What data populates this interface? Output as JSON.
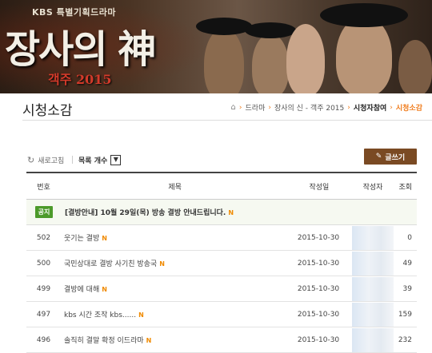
{
  "banner": {
    "network": "KBS 특별기획드라마",
    "title": "장사의 神",
    "subtitle": "객주 2015"
  },
  "page": {
    "title": "시청소감"
  },
  "breadcrumb": {
    "items": [
      "드라마",
      "장사의 신 - 객주 2015",
      "시청자참여",
      "시청소감"
    ]
  },
  "toolbar": {
    "refresh_label": "새로고침",
    "list_count_label": "목록 개수",
    "select_arrow": "▼",
    "write_label": "글쓰기"
  },
  "table": {
    "headers": [
      "번호",
      "제목",
      "작성일",
      "작성자",
      "조회"
    ],
    "notice": {
      "badge": "공지",
      "title": "[결방안내] 10월 29일(목) 방송 결방 안내드립니다.",
      "new_marker": "N"
    },
    "rows": [
      {
        "num": "502",
        "title": "웃기는 결방",
        "new": "N",
        "date": "2015-10-30",
        "views": "0"
      },
      {
        "num": "500",
        "title": "국민상대로 결방 사기친 방송국",
        "new": "N",
        "date": "2015-10-30",
        "views": "49"
      },
      {
        "num": "499",
        "title": "결방에 대해",
        "new": "N",
        "date": "2015-10-30",
        "views": "39"
      },
      {
        "num": "497",
        "title": "kbs 시간 조작 kbs......",
        "new": "N",
        "date": "2015-10-30",
        "views": "159"
      },
      {
        "num": "496",
        "title": "솔직히 결말 확정 이드라마",
        "new": "N",
        "date": "2015-10-30",
        "views": "232"
      }
    ]
  },
  "colors": {
    "accent_orange": "#f07b1a",
    "write_button": "#7a4a23",
    "notice_badge": "#4c9a2a"
  }
}
